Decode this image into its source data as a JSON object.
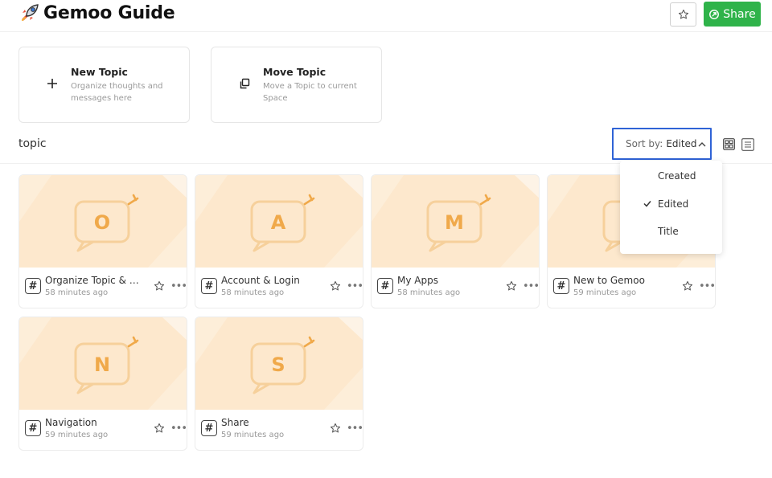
{
  "header": {
    "title": "Gemoo Guide",
    "share_label": "Share"
  },
  "actions": [
    {
      "title": "New Topic",
      "desc": "Organize thoughts and messages here",
      "icon": "plus-icon"
    },
    {
      "title": "Move Topic",
      "desc": "Move a Topic to current Space",
      "icon": "move-icon"
    }
  ],
  "section": {
    "title": "topic",
    "sort_prefix": "Sort by:",
    "sort_value": "Edited"
  },
  "sort_options": [
    {
      "label": "Created",
      "selected": false
    },
    {
      "label": "Edited",
      "selected": true
    },
    {
      "label": "Title",
      "selected": false
    }
  ],
  "topics": [
    {
      "letter": "O",
      "name": "Organize Topic & S...",
      "time": "58 minutes ago"
    },
    {
      "letter": "A",
      "name": "Account & Login",
      "time": "58 minutes ago"
    },
    {
      "letter": "M",
      "name": "My Apps",
      "time": "58 minutes ago"
    },
    {
      "letter": "",
      "name": "New to Gemoo",
      "time": "59 minutes ago"
    },
    {
      "letter": "N",
      "name": "Navigation",
      "time": "59 minutes ago"
    },
    {
      "letter": "S",
      "name": "Share",
      "time": "59 minutes ago"
    }
  ],
  "colors": {
    "accent_green": "#2fb34a",
    "focus_blue": "#2f63d6",
    "thumb_bg": "#fdeed9",
    "thumb_letter": "#f0a94a"
  }
}
